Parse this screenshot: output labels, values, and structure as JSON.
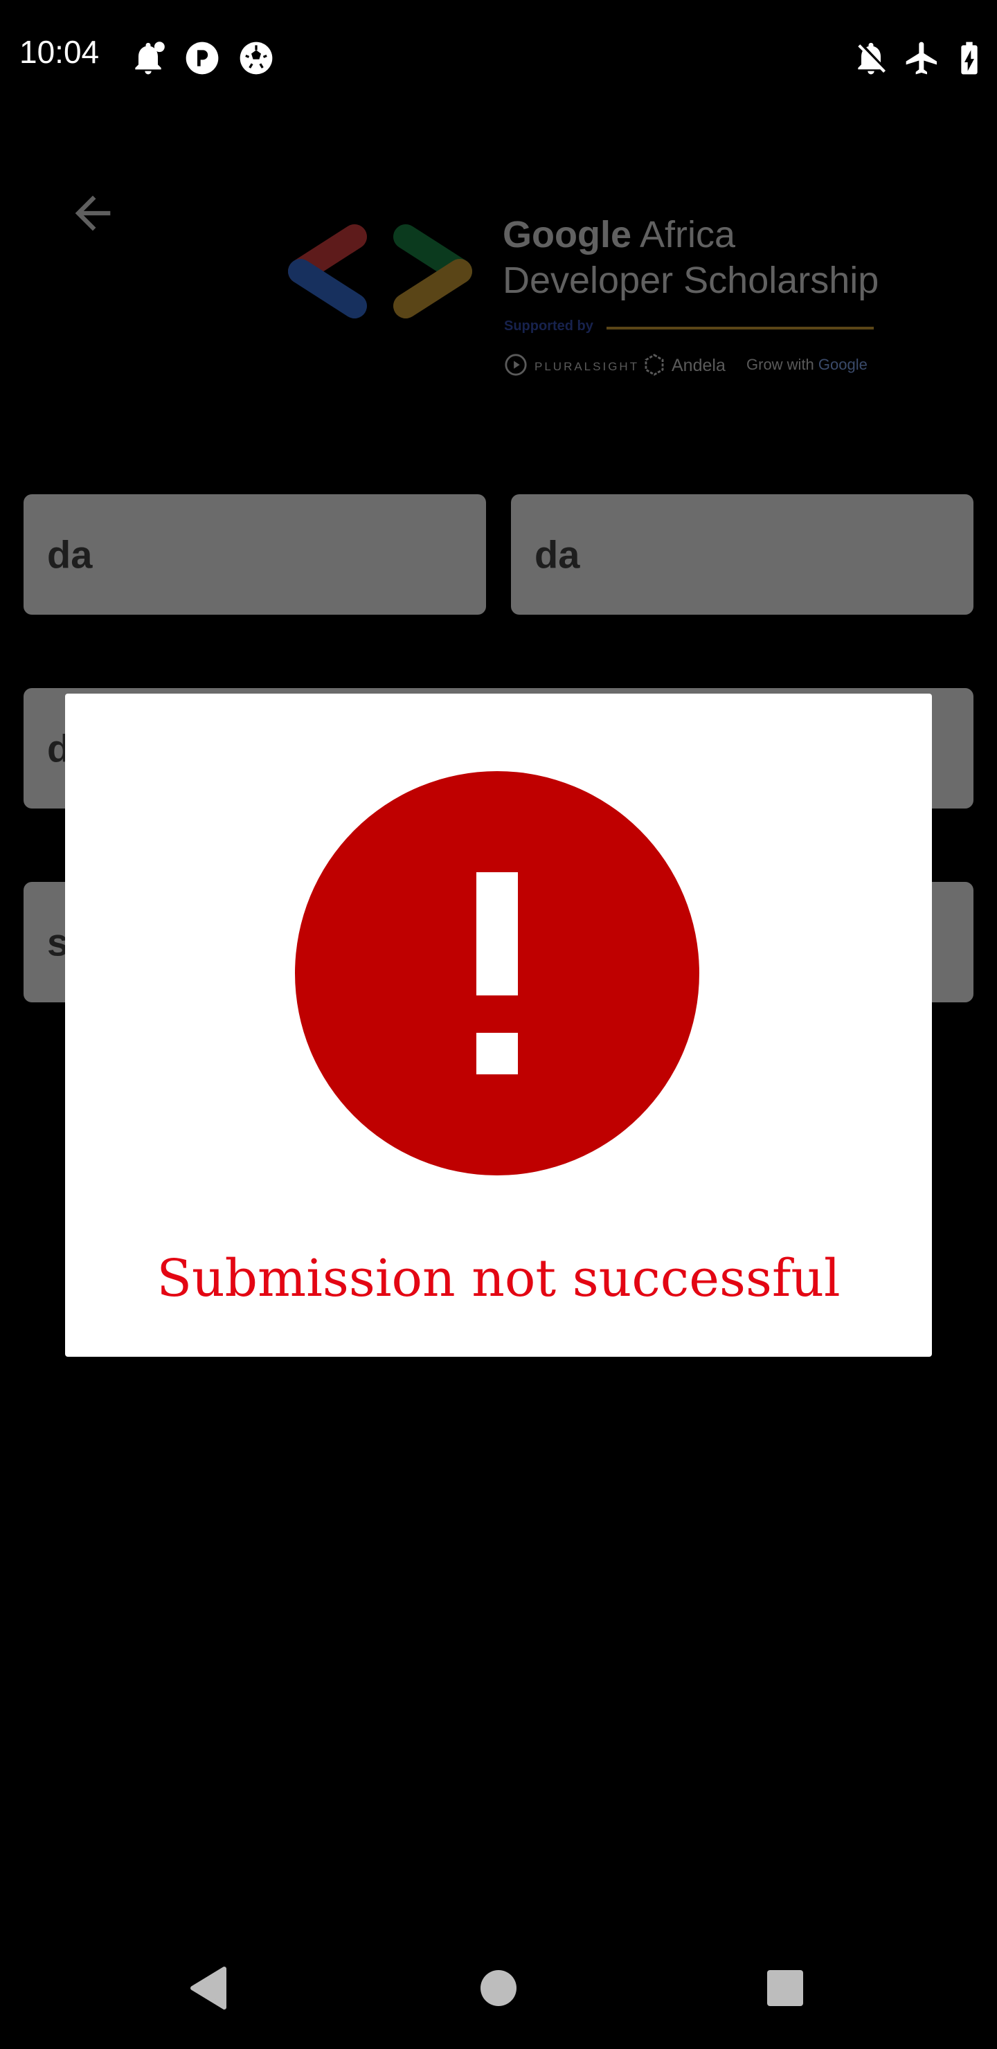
{
  "status_bar": {
    "time": "10:04",
    "left_icons": [
      "notification-bell-icon",
      "app-notification-icon",
      "soccer-ball-icon"
    ],
    "right_icons": [
      "notifications-off-icon",
      "airplane-mode-icon",
      "battery-charging-icon"
    ]
  },
  "header": {
    "back_icon": "arrow-back-icon",
    "logo": {
      "title_strong": "Google",
      "title_rest": " Africa",
      "title_line2": "Developer Scholarship",
      "supported_by": "Supported by",
      "sponsors": [
        "PLURALSIGHT",
        "Andela",
        "Grow with",
        "Google"
      ],
      "colors": {
        "red": "#5e1b1b",
        "blue": "#17305e",
        "green": "#0b3a1e",
        "yellow": "#5a4517"
      }
    }
  },
  "form": {
    "first_name_value": "da",
    "last_name_value": "da",
    "email_value_visible": "d",
    "github_value_visible": "s"
  },
  "dialog": {
    "icon": "error-exclamation-icon",
    "icon_color": "#bf0000",
    "message": "Submission not successful",
    "message_color": "#e30613"
  },
  "nav_bar": {
    "buttons": [
      "back-triangle-icon",
      "home-circle-icon",
      "recents-square-icon"
    ]
  }
}
